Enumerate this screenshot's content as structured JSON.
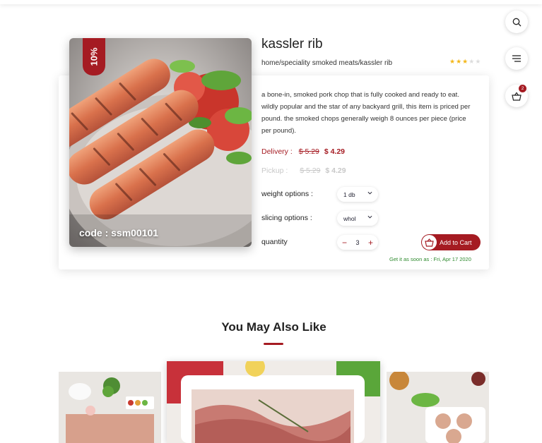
{
  "product": {
    "title": "kassler rib",
    "breadcrumb": "home/speciality smoked meats/kassler rib",
    "discount": "10%",
    "code": "code : ssm00101",
    "rating": 3,
    "rating_max": 5,
    "description": "a bone-in, smoked pork chop that is fully cooked and ready to eat. wildly popular and the star of any backyard grill, this item is priced per pound. the smoked chops generally weigh 8 ounces per piece (price per pound).",
    "delivery": {
      "label": "Delivery :",
      "old_price": "$ 5.29",
      "new_price": "$ 4.29"
    },
    "pickup": {
      "label": "Pickup :",
      "old_price": "$ 5.29",
      "new_price": "$ 4.29"
    },
    "weight": {
      "label": "weight options :",
      "value": "1 db"
    },
    "slicing": {
      "label": "slicing options :",
      "value": "whol"
    },
    "quantity": {
      "label": "quantity",
      "value": "3",
      "minus": "−",
      "plus": "+"
    },
    "add_to_cart": "Add to Cart",
    "ship_note": "Get it as soon as : Fri, Apr 17 2020"
  },
  "side": {
    "cart_count": "2"
  },
  "recommendations": {
    "title": "You May Also Like"
  },
  "colors": {
    "accent": "#a51b22",
    "star": "#f3b71a",
    "ship": "#2d8a2d"
  }
}
